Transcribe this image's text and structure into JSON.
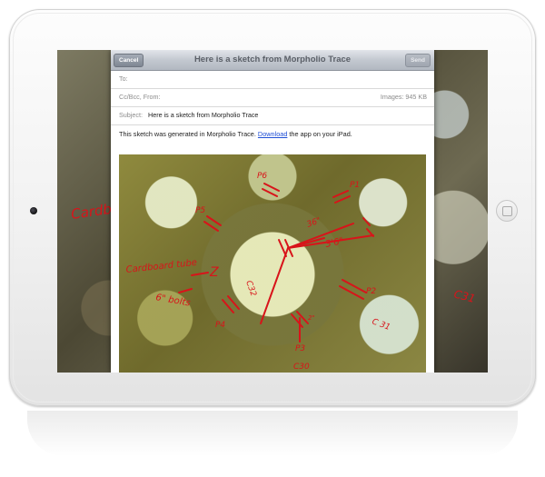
{
  "mail": {
    "title": "Here is a sketch from Morpholio Trace",
    "cancel_label": "Cancel",
    "send_label": "Send",
    "to_label": "To:",
    "cc_label": "Cc/Bcc, From:",
    "images_size": "Images: 945 KB",
    "subject_label": "Subject:",
    "subject_value": "Here is a sketch from Morpholio Trace",
    "body_prefix": "This sketch was generated in Morpholio Trace.",
    "body_link": "Download",
    "body_suffix": "the app on your iPad."
  },
  "sketch_labels": {
    "p6": "P6",
    "p1": "P1",
    "p5": "P5",
    "p2": "P2",
    "p4": "P4",
    "p3": "P3",
    "d36": "36\"",
    "d316": "3'6\"",
    "c32": "C32",
    "c31": "C 31",
    "c30": "C30",
    "d2": "2\"",
    "d6": "6\" bolts",
    "cardboard": "Cardboard tube",
    "z": "Z"
  },
  "background_labels": {
    "cardboard_partial": "Cardbo",
    "c31_partial": "C31"
  },
  "colors": {
    "sketch_ink": "#d8141a",
    "link": "#1f4fd6",
    "navbar": "#c3c8d0"
  }
}
